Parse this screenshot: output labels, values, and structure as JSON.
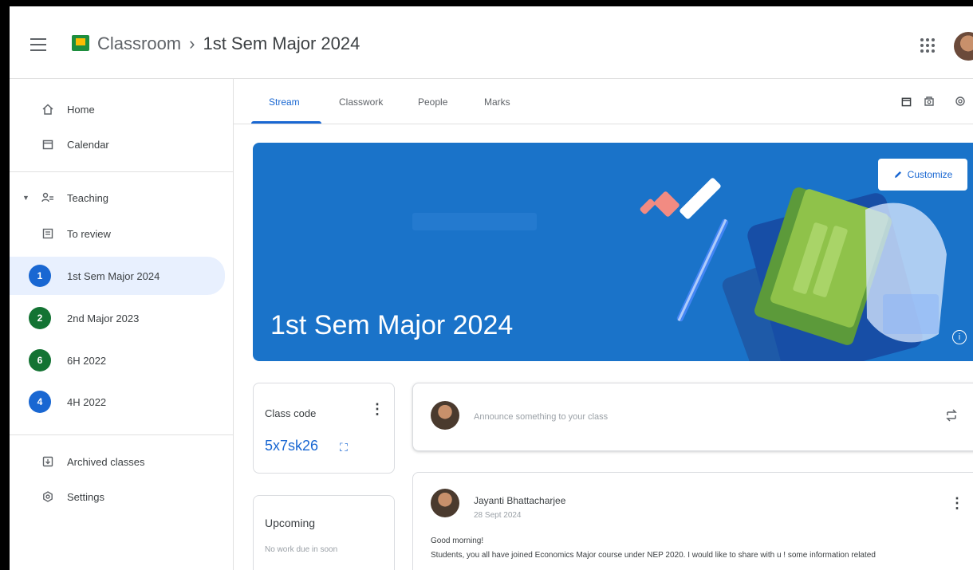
{
  "header": {
    "app_name": "Classroom",
    "separator": "›",
    "class_name": "1st Sem Major 2024"
  },
  "sidebar": {
    "home": "Home",
    "calendar": "Calendar",
    "teaching": "Teaching",
    "to_review": "To review",
    "classes": [
      {
        "badge": "1",
        "label": "1st Sem Major 2024",
        "color": "#1967d2"
      },
      {
        "badge": "2",
        "label": "2nd Major 2023",
        "color": "#137333"
      },
      {
        "badge": "6",
        "label": "6H 2022",
        "color": "#137333"
      },
      {
        "badge": "4",
        "label": "4H 2022",
        "color": "#1967d2"
      }
    ],
    "archived": "Archived classes",
    "settings": "Settings"
  },
  "tabs": [
    "Stream",
    "Classwork",
    "People",
    "Marks"
  ],
  "banner": {
    "title": "1st Sem Major 2024",
    "customize": "Customize",
    "color": "#1a73c9"
  },
  "class_code": {
    "label": "Class code",
    "code": "5x7sk26"
  },
  "upcoming": {
    "title": "Upcoming",
    "empty": "No work due in soon"
  },
  "announce": {
    "placeholder": "Announce something to your class"
  },
  "post": {
    "author": "Jayanti Bhattacharjee",
    "date": "28 Sept 2024",
    "greeting": "Good morning!",
    "body": "Students, you all have joined Economics Major course under NEP 2020. I would like to share with u ! some information related"
  }
}
